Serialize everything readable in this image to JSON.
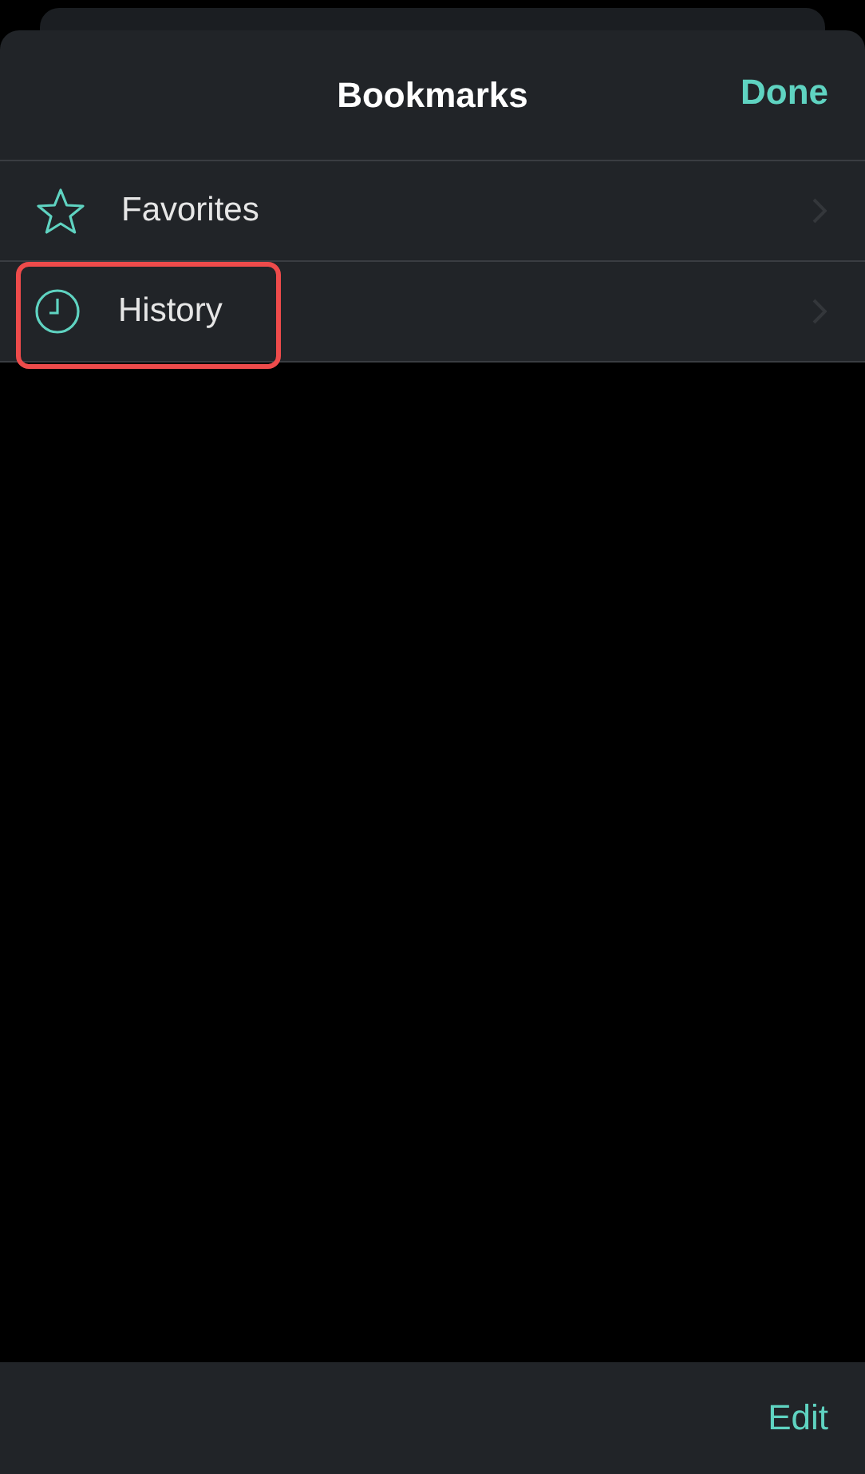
{
  "header": {
    "title": "Bookmarks",
    "done_button": "Done"
  },
  "items": [
    {
      "label": "Favorites",
      "kind": "star",
      "highlighted": false
    },
    {
      "label": "History",
      "kind": "clock",
      "highlighted": true
    }
  ],
  "toolbar": {
    "edit_button": "Edit"
  }
}
